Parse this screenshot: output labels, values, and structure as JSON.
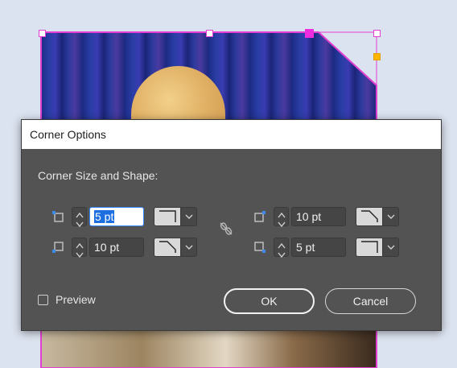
{
  "dialog": {
    "title": "Corner Options",
    "section_label": "Corner Size and Shape:",
    "corners": {
      "top_left": {
        "size": "5 pt",
        "shape": "fancy-corner"
      },
      "top_right": {
        "size": "10 pt",
        "shape": "bevel-corner"
      },
      "bottom_left": {
        "size": "10 pt",
        "shape": "bevel-corner"
      },
      "bottom_right": {
        "size": "5 pt",
        "shape": "fancy-corner"
      }
    },
    "preview_label": "Preview",
    "preview_checked": false,
    "ok_label": "OK",
    "cancel_label": "Cancel"
  },
  "colors": {
    "selection_frame": "#e23fd1",
    "dialog_bg": "#535353",
    "canvas_bg": "#dce3f0",
    "text_highlight": "#1d6ee0"
  }
}
